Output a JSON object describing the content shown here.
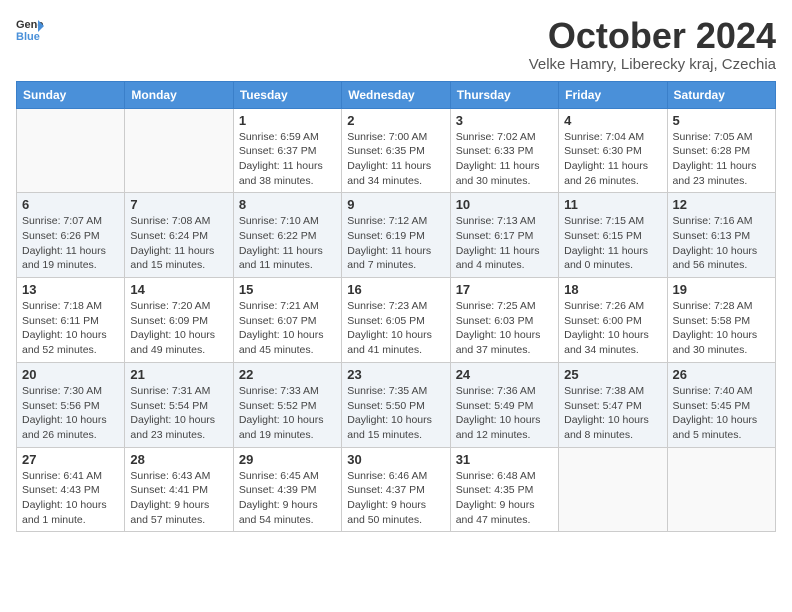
{
  "header": {
    "logo_line1": "General",
    "logo_line2": "Blue",
    "month": "October 2024",
    "location": "Velke Hamry, Liberecky kraj, Czechia"
  },
  "weekdays": [
    "Sunday",
    "Monday",
    "Tuesday",
    "Wednesday",
    "Thursday",
    "Friday",
    "Saturday"
  ],
  "weeks": [
    [
      {
        "day": "",
        "sunrise": "",
        "sunset": "",
        "daylight": ""
      },
      {
        "day": "",
        "sunrise": "",
        "sunset": "",
        "daylight": ""
      },
      {
        "day": "1",
        "sunrise": "Sunrise: 6:59 AM",
        "sunset": "Sunset: 6:37 PM",
        "daylight": "Daylight: 11 hours and 38 minutes."
      },
      {
        "day": "2",
        "sunrise": "Sunrise: 7:00 AM",
        "sunset": "Sunset: 6:35 PM",
        "daylight": "Daylight: 11 hours and 34 minutes."
      },
      {
        "day": "3",
        "sunrise": "Sunrise: 7:02 AM",
        "sunset": "Sunset: 6:33 PM",
        "daylight": "Daylight: 11 hours and 30 minutes."
      },
      {
        "day": "4",
        "sunrise": "Sunrise: 7:04 AM",
        "sunset": "Sunset: 6:30 PM",
        "daylight": "Daylight: 11 hours and 26 minutes."
      },
      {
        "day": "5",
        "sunrise": "Sunrise: 7:05 AM",
        "sunset": "Sunset: 6:28 PM",
        "daylight": "Daylight: 11 hours and 23 minutes."
      }
    ],
    [
      {
        "day": "6",
        "sunrise": "Sunrise: 7:07 AM",
        "sunset": "Sunset: 6:26 PM",
        "daylight": "Daylight: 11 hours and 19 minutes."
      },
      {
        "day": "7",
        "sunrise": "Sunrise: 7:08 AM",
        "sunset": "Sunset: 6:24 PM",
        "daylight": "Daylight: 11 hours and 15 minutes."
      },
      {
        "day": "8",
        "sunrise": "Sunrise: 7:10 AM",
        "sunset": "Sunset: 6:22 PM",
        "daylight": "Daylight: 11 hours and 11 minutes."
      },
      {
        "day": "9",
        "sunrise": "Sunrise: 7:12 AM",
        "sunset": "Sunset: 6:19 PM",
        "daylight": "Daylight: 11 hours and 7 minutes."
      },
      {
        "day": "10",
        "sunrise": "Sunrise: 7:13 AM",
        "sunset": "Sunset: 6:17 PM",
        "daylight": "Daylight: 11 hours and 4 minutes."
      },
      {
        "day": "11",
        "sunrise": "Sunrise: 7:15 AM",
        "sunset": "Sunset: 6:15 PM",
        "daylight": "Daylight: 11 hours and 0 minutes."
      },
      {
        "day": "12",
        "sunrise": "Sunrise: 7:16 AM",
        "sunset": "Sunset: 6:13 PM",
        "daylight": "Daylight: 10 hours and 56 minutes."
      }
    ],
    [
      {
        "day": "13",
        "sunrise": "Sunrise: 7:18 AM",
        "sunset": "Sunset: 6:11 PM",
        "daylight": "Daylight: 10 hours and 52 minutes."
      },
      {
        "day": "14",
        "sunrise": "Sunrise: 7:20 AM",
        "sunset": "Sunset: 6:09 PM",
        "daylight": "Daylight: 10 hours and 49 minutes."
      },
      {
        "day": "15",
        "sunrise": "Sunrise: 7:21 AM",
        "sunset": "Sunset: 6:07 PM",
        "daylight": "Daylight: 10 hours and 45 minutes."
      },
      {
        "day": "16",
        "sunrise": "Sunrise: 7:23 AM",
        "sunset": "Sunset: 6:05 PM",
        "daylight": "Daylight: 10 hours and 41 minutes."
      },
      {
        "day": "17",
        "sunrise": "Sunrise: 7:25 AM",
        "sunset": "Sunset: 6:03 PM",
        "daylight": "Daylight: 10 hours and 37 minutes."
      },
      {
        "day": "18",
        "sunrise": "Sunrise: 7:26 AM",
        "sunset": "Sunset: 6:00 PM",
        "daylight": "Daylight: 10 hours and 34 minutes."
      },
      {
        "day": "19",
        "sunrise": "Sunrise: 7:28 AM",
        "sunset": "Sunset: 5:58 PM",
        "daylight": "Daylight: 10 hours and 30 minutes."
      }
    ],
    [
      {
        "day": "20",
        "sunrise": "Sunrise: 7:30 AM",
        "sunset": "Sunset: 5:56 PM",
        "daylight": "Daylight: 10 hours and 26 minutes."
      },
      {
        "day": "21",
        "sunrise": "Sunrise: 7:31 AM",
        "sunset": "Sunset: 5:54 PM",
        "daylight": "Daylight: 10 hours and 23 minutes."
      },
      {
        "day": "22",
        "sunrise": "Sunrise: 7:33 AM",
        "sunset": "Sunset: 5:52 PM",
        "daylight": "Daylight: 10 hours and 19 minutes."
      },
      {
        "day": "23",
        "sunrise": "Sunrise: 7:35 AM",
        "sunset": "Sunset: 5:50 PM",
        "daylight": "Daylight: 10 hours and 15 minutes."
      },
      {
        "day": "24",
        "sunrise": "Sunrise: 7:36 AM",
        "sunset": "Sunset: 5:49 PM",
        "daylight": "Daylight: 10 hours and 12 minutes."
      },
      {
        "day": "25",
        "sunrise": "Sunrise: 7:38 AM",
        "sunset": "Sunset: 5:47 PM",
        "daylight": "Daylight: 10 hours and 8 minutes."
      },
      {
        "day": "26",
        "sunrise": "Sunrise: 7:40 AM",
        "sunset": "Sunset: 5:45 PM",
        "daylight": "Daylight: 10 hours and 5 minutes."
      }
    ],
    [
      {
        "day": "27",
        "sunrise": "Sunrise: 6:41 AM",
        "sunset": "Sunset: 4:43 PM",
        "daylight": "Daylight: 10 hours and 1 minute."
      },
      {
        "day": "28",
        "sunrise": "Sunrise: 6:43 AM",
        "sunset": "Sunset: 4:41 PM",
        "daylight": "Daylight: 9 hours and 57 minutes."
      },
      {
        "day": "29",
        "sunrise": "Sunrise: 6:45 AM",
        "sunset": "Sunset: 4:39 PM",
        "daylight": "Daylight: 9 hours and 54 minutes."
      },
      {
        "day": "30",
        "sunrise": "Sunrise: 6:46 AM",
        "sunset": "Sunset: 4:37 PM",
        "daylight": "Daylight: 9 hours and 50 minutes."
      },
      {
        "day": "31",
        "sunrise": "Sunrise: 6:48 AM",
        "sunset": "Sunset: 4:35 PM",
        "daylight": "Daylight: 9 hours and 47 minutes."
      },
      {
        "day": "",
        "sunrise": "",
        "sunset": "",
        "daylight": ""
      },
      {
        "day": "",
        "sunrise": "",
        "sunset": "",
        "daylight": ""
      }
    ]
  ]
}
